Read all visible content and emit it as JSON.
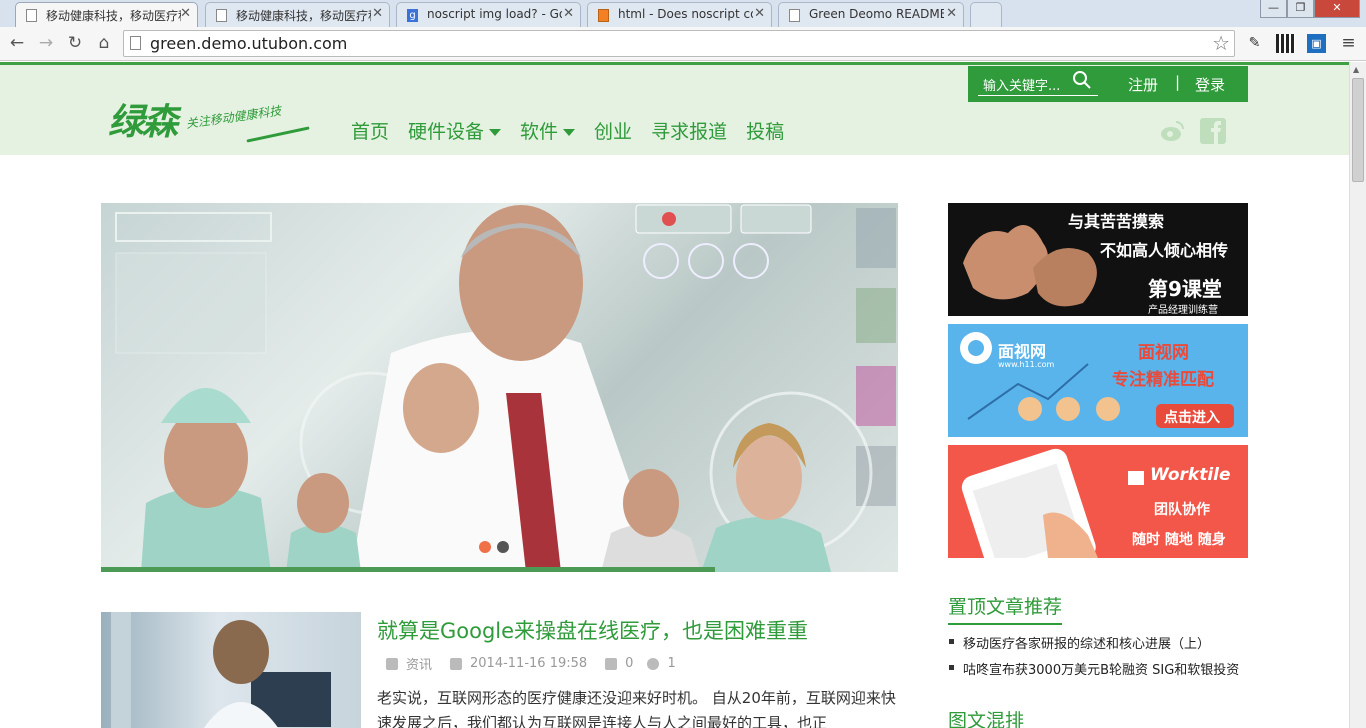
{
  "browser": {
    "tabs": [
      {
        "title": "移动健康科技，移动医疗科技",
        "active": true,
        "favicon": "page-icon"
      },
      {
        "title": "移动健康科技，移动医疗科技",
        "active": false,
        "favicon": "page-icon"
      },
      {
        "title": "noscript img load? - Google",
        "active": false,
        "favicon": "google-icon"
      },
      {
        "title": "html - Does noscript co",
        "active": false,
        "favicon": "stackoverflow-icon"
      },
      {
        "title": "Green Deomo README",
        "active": false,
        "favicon": "page-icon"
      }
    ],
    "url": "green.demo.utubon.com",
    "window_controls": {
      "minimize": "—",
      "maximize": "❐",
      "close": "✕"
    }
  },
  "site": {
    "logo_text": "绿森",
    "logo_slogan": "关注移动健康科技",
    "search_placeholder": "输入关键字...",
    "register": "注册",
    "separator": "|",
    "login": "登录",
    "nav": [
      {
        "label": "首页",
        "dropdown": false
      },
      {
        "label": "硬件设备",
        "dropdown": true
      },
      {
        "label": "软件",
        "dropdown": true
      },
      {
        "label": "创业",
        "dropdown": false
      },
      {
        "label": "寻求报道",
        "dropdown": false
      },
      {
        "label": "投稿",
        "dropdown": false
      }
    ],
    "social": [
      "weibo-icon",
      "facebook-icon"
    ],
    "accent_color": "#2f9b3a"
  },
  "slider": {
    "active_dot_color": "#f0704a",
    "dot_color": "#555555",
    "progress": 0.77
  },
  "ads": [
    {
      "line1": "与其苦苦摸索",
      "line2": "不如高人倾心相传",
      "brand": "第9课堂",
      "sub": "产品经理训练营"
    },
    {
      "brand": "面视网",
      "site": "www.h11.com",
      "headline": "面视网",
      "tagline": "专注精准匹配",
      "cta": "点击进入"
    },
    {
      "brand": "Worktile",
      "line1": "团队协作",
      "line2": "随时 随地 随身"
    }
  ],
  "sidebar": {
    "top_title": "置顶文章推荐",
    "top_posts": [
      "移动医疗各家研报的综述和核心进展（上）",
      "咕咚宣布获3000万美元B轮融资 SIG和软银投资"
    ],
    "mixed_title": "图文混排"
  },
  "article": {
    "title": "就算是Google来操盘在线医疗，也是困难重重",
    "category": "资讯",
    "date": "2014-11-16 19:58",
    "comments": "0",
    "views": "1",
    "excerpt": "老实说，互联网形态的医疗健康还没迎来好时机。 自从20年前，互联网迎来快速发展之后，我们都认为互联网是连接人与人之间最好的工具，也正"
  }
}
